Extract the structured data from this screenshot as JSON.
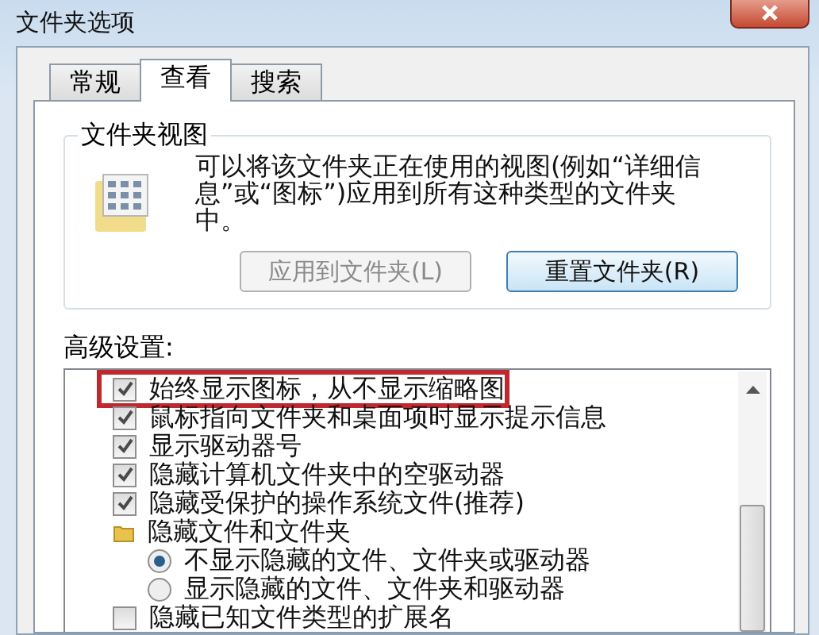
{
  "window": {
    "title": "文件夹选项"
  },
  "tabs": [
    {
      "label": "常规",
      "selected": false
    },
    {
      "label": "查看",
      "selected": true
    },
    {
      "label": "搜索",
      "selected": false
    }
  ],
  "folder_views": {
    "title": "文件夹视图",
    "description": "可以将该文件夹正在使用的视图(例如“详细信息”或“图标”)应用到所有这种类型的文件夹中。",
    "buttons": [
      {
        "label": "应用到文件夹(L)",
        "disabled": true
      },
      {
        "label": "重置文件夹(R)",
        "disabled": false
      }
    ]
  },
  "advanced": {
    "title": "高级设置:",
    "items": [
      {
        "kind": "checkbox",
        "label": "始终显示图标，从不显示缩略图",
        "checked": true,
        "highlighted": true
      },
      {
        "kind": "checkbox",
        "label": "鼠标指向文件夹和桌面项时显示提示信息",
        "checked": true,
        "highlighted": false
      },
      {
        "kind": "checkbox",
        "label": "显示驱动器号",
        "checked": true,
        "highlighted": false
      },
      {
        "kind": "checkbox",
        "label": "隐藏计算机文件夹中的空驱动器",
        "checked": true,
        "highlighted": false
      },
      {
        "kind": "checkbox",
        "label": "隐藏受保护的操作系统文件(推荐)",
        "checked": true,
        "highlighted": false
      },
      {
        "kind": "folder",
        "label": "隐藏文件和文件夹",
        "highlighted": false,
        "children": [
          {
            "kind": "radio",
            "label": "不显示隐藏的文件、文件夹或驱动器",
            "selected": true
          },
          {
            "kind": "radio",
            "label": "显示隐藏的文件、文件夹和驱动器",
            "selected": false
          }
        ]
      },
      {
        "kind": "checkbox",
        "label": "隐藏已知文件类型的扩展名",
        "checked": false,
        "highlighted": false
      }
    ]
  }
}
